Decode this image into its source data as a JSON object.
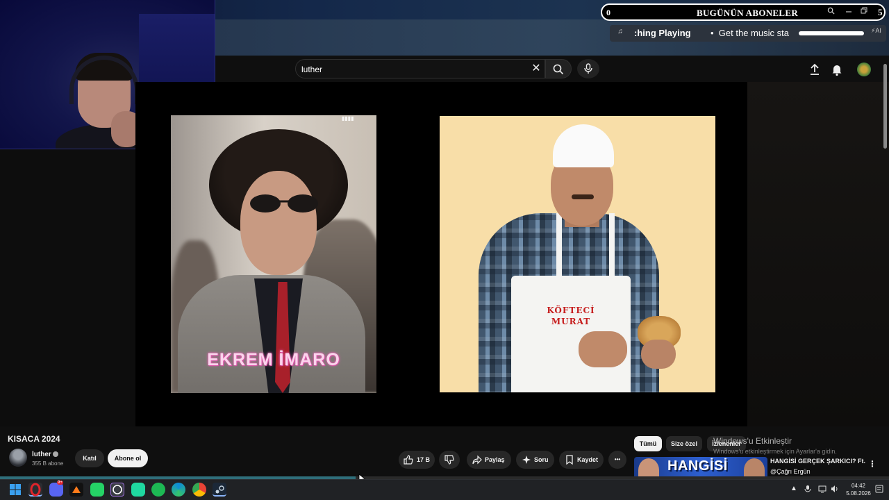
{
  "stream_overlay": {
    "subscriber_count": "0",
    "subscriber_title": "BUGÜNÜN ABONELER",
    "subscriber_right_digit": "5",
    "now_playing_prefix": ":hing Playing",
    "now_playing_bullet": "•",
    "now_playing_text": "Get the music sta",
    "now_playing_ai": "⚡AI"
  },
  "youtube": {
    "search": {
      "value": "luther",
      "placeholder": ""
    },
    "video": {
      "title": "KISACA 2024",
      "left_caption": "EKREM İMARO",
      "left_watermark": "▮▮▮▮",
      "right_apron_line1": "KÖFTECİ",
      "right_apron_line2": "MURAT"
    },
    "channel": {
      "name": "luther",
      "subscribers": "355 B abone",
      "join_label": "Katıl",
      "subscribe_label": "Abone ol"
    },
    "actions": {
      "likes": "17 B",
      "share_label": "Paylaş",
      "ask_label": "Soru",
      "save_label": "Kaydet",
      "more_label": "•••"
    },
    "chips": [
      "Tümü",
      "Size özel",
      "İzlenenler"
    ],
    "windows_activation": {
      "title": "Windows'u Etkinleştir",
      "subtitle": "Windows'u etkinleştirmek için Ayarlar'a gidin."
    },
    "next_video": {
      "thumbnail_text": "HANGİSİ",
      "title": "HANGİSİ GERÇEK ŞARKICI? Ft.",
      "channel": "@Çağrı Ergün",
      "more_label": "⋮"
    },
    "progress_fraction": 0.4
  },
  "taskbar": {
    "clock_time": "04:42",
    "clock_date": "5.08.2026",
    "discord_badge": "9+"
  },
  "colors": {
    "subscribe_bg": "#f1f1f1",
    "caption_pink": "#fbd4ec",
    "apron_red": "#c61e1e",
    "accent_blue": "#2d5fd0"
  }
}
